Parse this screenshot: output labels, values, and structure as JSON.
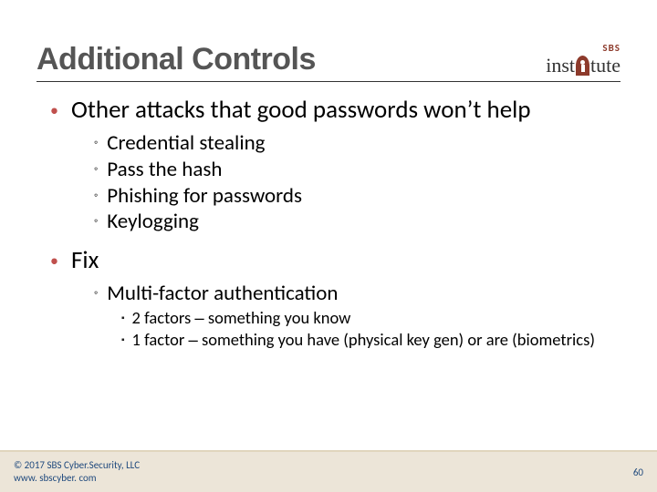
{
  "header": {
    "title": "Additional Controls",
    "logo": {
      "sbs": "SBS",
      "prefix": "inst",
      "suffix": "tute"
    }
  },
  "content": {
    "item1": {
      "text": "Other attacks that good passwords won’t help",
      "sub": {
        "a": "Credential stealing",
        "b": "Pass the hash",
        "c": "Phishing for passwords",
        "d": "Keylogging"
      }
    },
    "item2": {
      "text": "Fix",
      "sub": {
        "a": "Multi-factor authentication",
        "detail": {
          "a_count": "2 factors",
          "a_rest": "something you know",
          "b_count": "1 factor",
          "b_rest": "something you have (physical key gen) or are (biometrics)"
        }
      }
    }
  },
  "footer": {
    "copyright": "© 2017 SBS Cyber.Security, LLC",
    "url": "www. sbscyber. com",
    "page": "60"
  }
}
